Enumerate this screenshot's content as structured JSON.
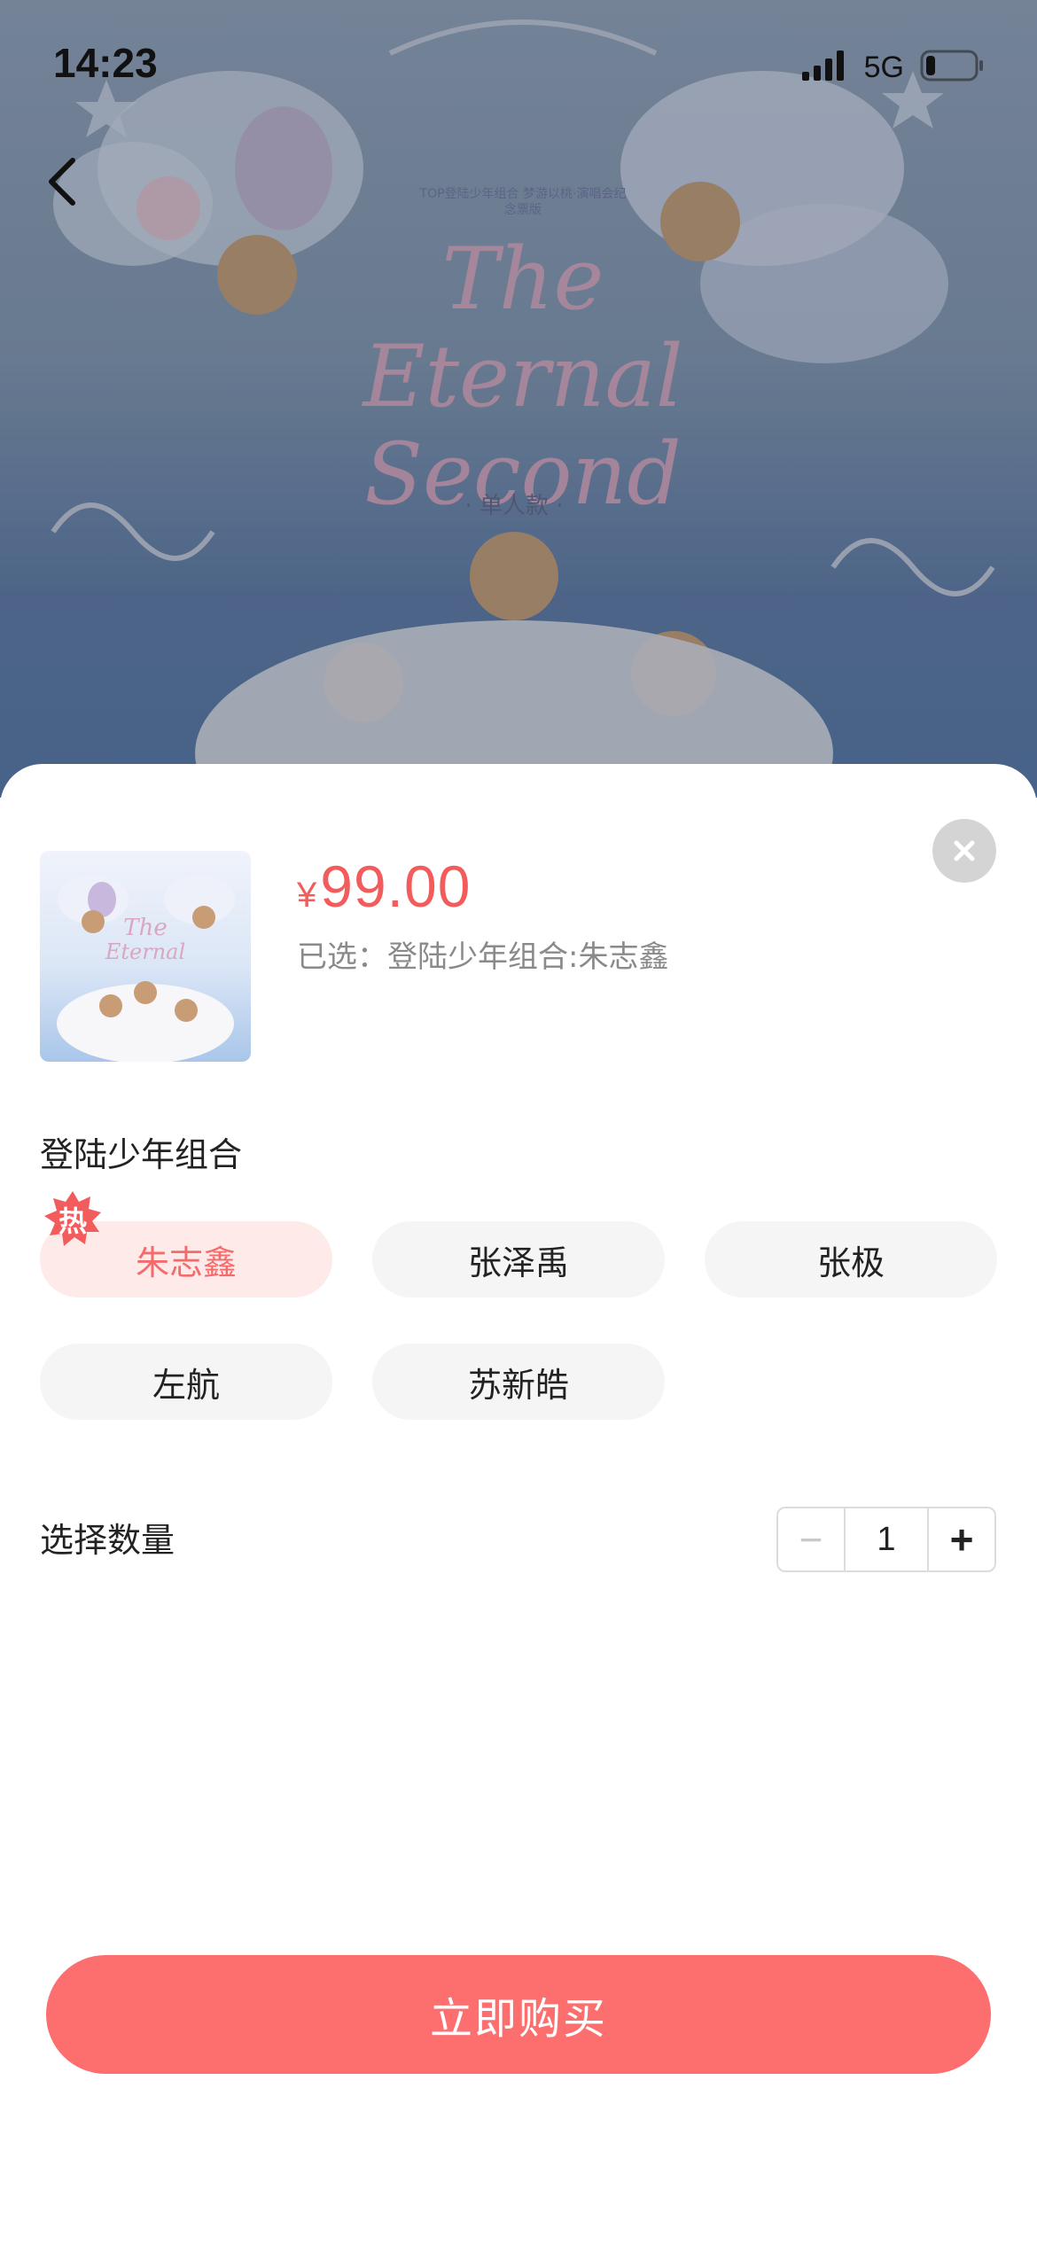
{
  "status_bar": {
    "time": "14:23",
    "network": "5G"
  },
  "poster": {
    "title": "The Eternal Second",
    "small_text": "TOP登陆少年组合 梦游以桃·演唱会纪念票版",
    "tag": "· 单人款 ·"
  },
  "sheet": {
    "currency": "¥",
    "price": "99.00",
    "selected": "已选：登陆少年组合:朱志鑫",
    "group_title": "登陆少年组合",
    "hot_badge": "热",
    "options": [
      {
        "label": "朱志鑫",
        "selected": true
      },
      {
        "label": "张泽禹",
        "selected": false
      },
      {
        "label": "张极",
        "selected": false
      },
      {
        "label": "左航",
        "selected": false
      },
      {
        "label": "苏新皓",
        "selected": false
      }
    ],
    "quantity_title": "选择数量",
    "quantity": "1",
    "minus": "−",
    "plus": "+",
    "buy_label": "立即购买"
  },
  "colors": {
    "accent": "#fd6e6e",
    "price": "#f25c5c",
    "chip_active_bg": "#ffeaea",
    "chip_bg": "#f5f5f5"
  },
  "icons": [
    "back-arrow-icon",
    "signal-icon",
    "battery-icon",
    "close-icon",
    "hot-badge-icon"
  ]
}
